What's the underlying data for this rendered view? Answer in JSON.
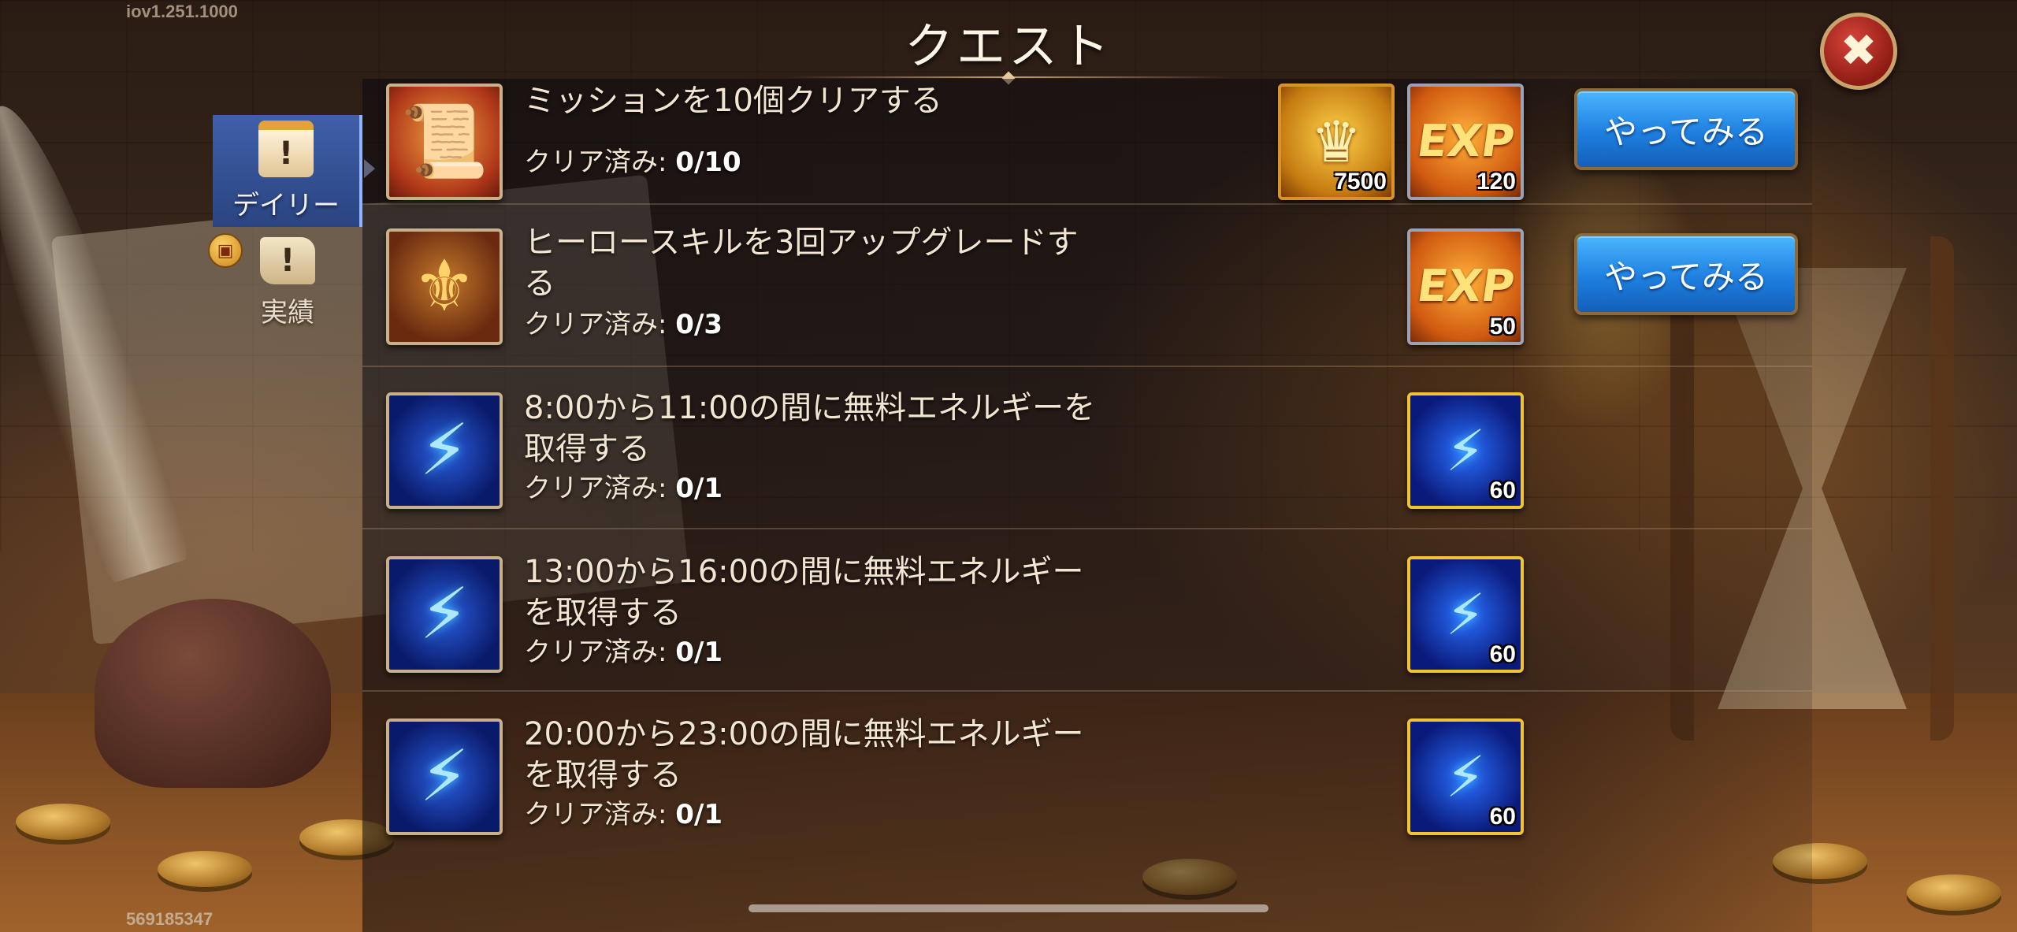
{
  "app": {
    "version": "iov1.251.1000",
    "user_id": "569185347",
    "title": "クエスト"
  },
  "sidebar": {
    "items": [
      {
        "label": "デイリー",
        "icon": "calendar-icon",
        "active": true
      },
      {
        "label": "実績",
        "icon": "scroll-icon",
        "active": false,
        "badge_icon": "gift-icon"
      }
    ]
  },
  "quests": [
    {
      "icon": "scroll-icon",
      "title": "ミッションを10個クリアする",
      "progress_label": "クリア済み:",
      "progress_value": "0/10",
      "rewards": [
        {
          "type": "gold-coin-icon",
          "amount": "7500"
        },
        {
          "type": "exp-icon",
          "glyph": "EXP",
          "amount": "120"
        }
      ],
      "button": "やってみる"
    },
    {
      "icon": "winged-helmet-icon",
      "title": "ヒーロースキルを3回アップグレードする",
      "progress_label": "クリア済み:",
      "progress_value": "0/3",
      "rewards": [
        {
          "type": "exp-icon",
          "glyph": "EXP",
          "amount": "50"
        }
      ],
      "button": "やってみる"
    },
    {
      "icon": "lightning-icon",
      "title": "8:00から11:00の間に無料エネルギーを取得する",
      "progress_label": "クリア済み:",
      "progress_value": "0/1",
      "rewards": [
        {
          "type": "energy-icon",
          "amount": "60"
        }
      ]
    },
    {
      "icon": "lightning-icon",
      "title": "13:00から16:00の間に無料エネルギーを取得する",
      "progress_label": "クリア済み:",
      "progress_value": "0/1",
      "rewards": [
        {
          "type": "energy-icon",
          "amount": "60"
        }
      ]
    },
    {
      "icon": "lightning-icon",
      "title": "20:00から23:00の間に無料エネルギーを取得する",
      "progress_label": "クリア済み:",
      "progress_value": "0/1",
      "rewards": [
        {
          "type": "energy-icon",
          "amount": "60"
        }
      ]
    }
  ],
  "colors": {
    "button_blue": "#1e7fe0",
    "active_tab": "#2a4481",
    "close_red": "#b82a20",
    "energy_border": "#f1c232"
  }
}
